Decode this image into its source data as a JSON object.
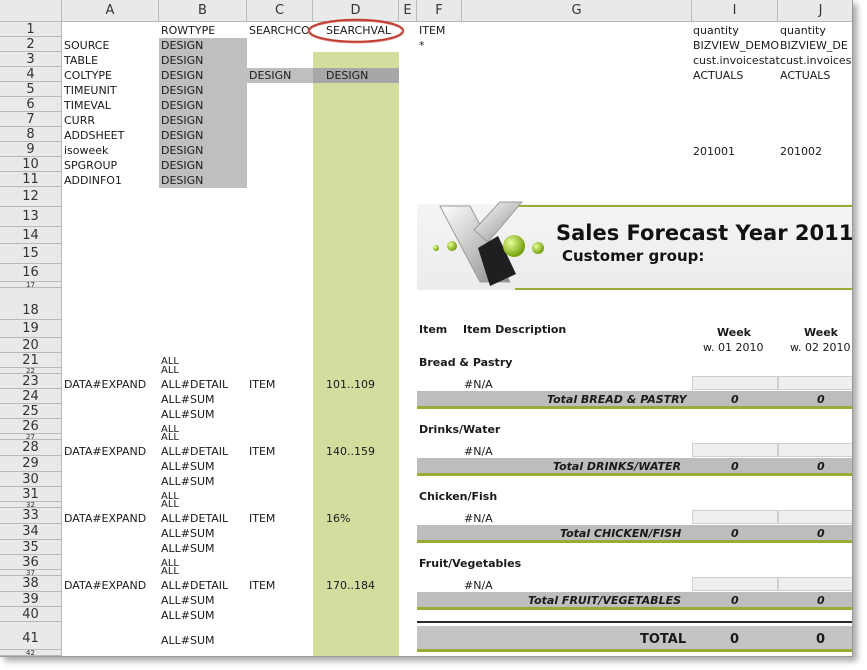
{
  "columns": [
    "A",
    "B",
    "C",
    "D",
    "E",
    "F",
    "G",
    "I",
    "J"
  ],
  "rows": [
    "1",
    "2",
    "3",
    "4",
    "5",
    "6",
    "7",
    "8",
    "9",
    "10",
    "11",
    "12",
    "13",
    "14",
    "15",
    "16",
    "17",
    "18",
    "19",
    "20",
    "21",
    "22",
    "23",
    "24",
    "25",
    "26",
    "27",
    "28",
    "29",
    "30",
    "31",
    "32",
    "33",
    "34",
    "35",
    "36",
    "37",
    "38",
    "39",
    "40",
    "41",
    "42"
  ],
  "header_rows": {
    "rowtype": "ROWTYPE",
    "searchcol": "SEARCHCO",
    "searchval": "SEARCHVAL",
    "item": "ITEM",
    "quantity_i": "quantity",
    "quantity_j": "quantity",
    "star": "*",
    "bizview_i": "BIZVIEW_DEMO",
    "bizview_j": "BIZVIEW_DE",
    "cust_i": "cust.invoicestat",
    "cust_j": "cust.invoices",
    "actuals_i": "ACTUALS",
    "actuals_j": "ACTUALS",
    "period_i": "201001",
    "period_j": "201002"
  },
  "col_a_labels": [
    "SOURCE",
    "TABLE",
    "COLTYPE",
    "TIMEUNIT",
    "TIMEVAL",
    "CURR",
    "ADDSHEET",
    "isoweek",
    "SPGROUP",
    "ADDINFO1"
  ],
  "design": "DESIGN",
  "report": {
    "title": "Sales Forecast Year 2011",
    "subtitle": "Customer group:",
    "col_item": "Item",
    "col_desc": "Item Description",
    "week_label": "Week",
    "week1": "w. 01 2010",
    "week2": "w. 02 2010",
    "na": "#N/A",
    "zero": "0",
    "total_label": "TOTAL"
  },
  "groups": [
    {
      "name": "Bread & Pastry",
      "total": "Total BREAD & PASTRY",
      "range": "101..109"
    },
    {
      "name": "Drinks/Water",
      "total": "Total DRINKS/WATER",
      "range": "140..159"
    },
    {
      "name": "Chicken/Fish",
      "total": "Total CHICKEN/FISH",
      "range": "16%"
    },
    {
      "name": "Fruit/Vegetables",
      "total": "Total FRUIT/VEGETABLES",
      "range": "170..184"
    }
  ],
  "block": {
    "all": "ALL",
    "data_expand": "DATA#EXPAND",
    "all_detail": "ALL#DETAIL",
    "item": "ITEM",
    "all_sum": "ALL#SUM"
  },
  "colors": {
    "gray_fill": "#bfbfbf",
    "green_fill": "#d4dc9e",
    "highlight_ring": "#c0392b",
    "accent_line": "#9aab38"
  }
}
